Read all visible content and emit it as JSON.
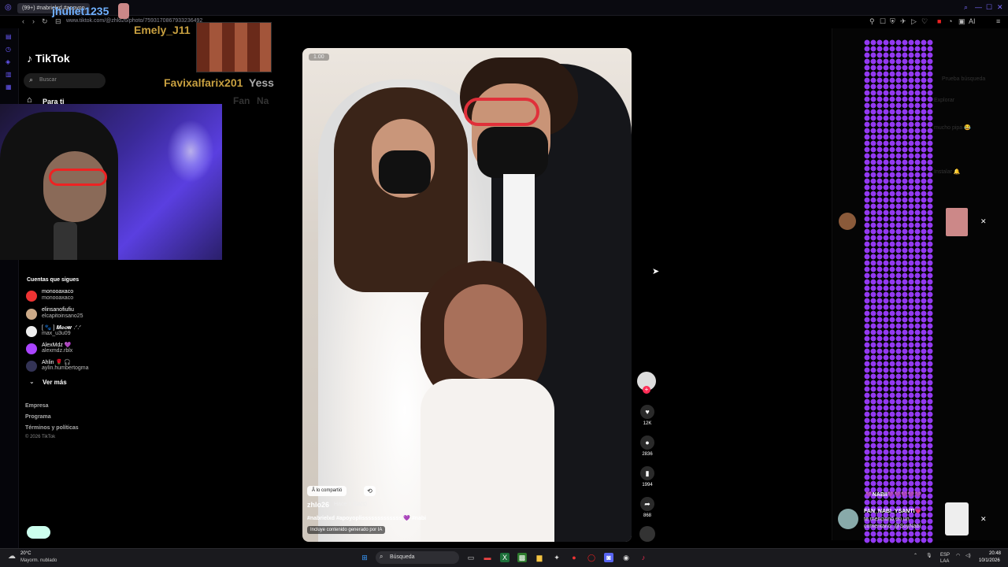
{
  "browser": {
    "tab_label": "(99+) #nabrielxd #apoyop",
    "url": "www.tiktok.com/@zhlo26/photo/7593170867933236492",
    "toolbar_right_label": "AI"
  },
  "overlay": {
    "stream_user": "jhuliet1235",
    "chat_name_1": "Emely_J11",
    "chat_name_2": "Favixalfarix201",
    "chat_name_3": "Yess",
    "chat_name_4": "Fan",
    "chat_name_5": "Na"
  },
  "sidebar": {
    "logo": "TikTok",
    "search_placeholder": "Buscar",
    "home_label": "Para ti",
    "following_title": "Cuentas que sigues",
    "accounts": [
      {
        "name": "monooaxaco",
        "handle": "monooaxaco",
        "color": "#e33"
      },
      {
        "name": "elinsanofiufiu",
        "handle": "elcapitoinsano25",
        "color": "#ca8"
      },
      {
        "name": "[ 🐾 ] 𝑴𝒆𝒐𝒘 .ᐟ.ᐟ",
        "handle": "max_u3u09",
        "color": "#eee"
      },
      {
        "name": "AlexMdz 💜",
        "handle": "alexmdz.rblx",
        "color": "#a4f"
      },
      {
        "name": "Ahlin 🌹 🎧",
        "handle": "aylin.humbertogma",
        "color": "#335"
      }
    ],
    "see_more": "Ver más",
    "footer_links": [
      "Empresa",
      "Programa",
      "Términos y políticas"
    ],
    "copyright": "© 2026 TikTok"
  },
  "post": {
    "slide_counter": "1.00",
    "shared_label": "Â lo compartió",
    "username": "zhlo26",
    "time": "Hace 1 día(s)",
    "hashtags": "#nabrielxd #apoyoplisssssssssssss 💜 #nabi",
    "ai_label": "Incluye contenido generado por IA",
    "likes": "12K",
    "comments": "2836",
    "saves": "1994",
    "shares": "868"
  },
  "chat": {
    "banner": "💜NABII💜💜💜💜💜",
    "notif_name": "FAN_NABI_YSANTI💗",
    "notif_text": "te mencionó en un comentario: @SoyNabi",
    "faint_1": "Prueba búsqueda",
    "faint_2": "Explorar",
    "faint_3": "mucho pipa 😂",
    "faint_4": "Instalar 🔔"
  },
  "taskbar": {
    "temp": "20°C",
    "weather": "Mayorm. nublado",
    "search": "Búsqueda",
    "lang1": "ESP",
    "lang2": "LAA",
    "time": "20:48",
    "date": "10/1/2026"
  },
  "colors": {
    "accent": "#fe2c55",
    "hearts": "#9a3cff",
    "overlay_gold": "#c8a040"
  }
}
